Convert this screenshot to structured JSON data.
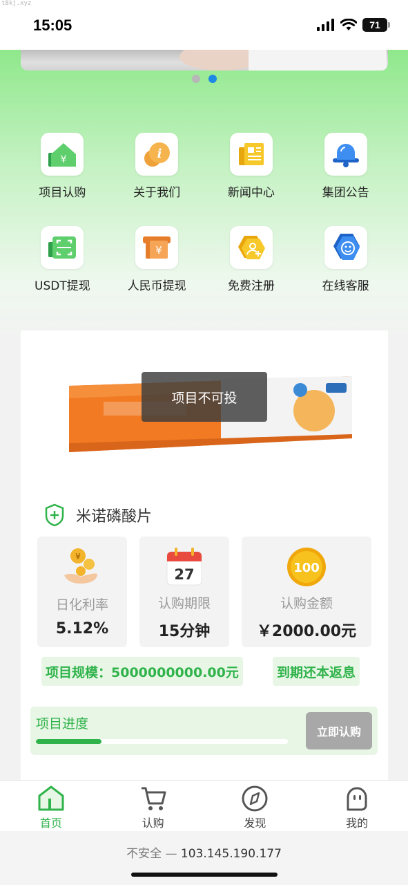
{
  "watermark": "t8kj.xyz",
  "status_bar": {
    "time": "15:05",
    "battery": "71"
  },
  "carousel": {
    "dots": 2,
    "active_index": 1
  },
  "menu": [
    {
      "label": "项目认购",
      "icon": "house-yen-icon"
    },
    {
      "label": "关于我们",
      "icon": "info-coin-icon"
    },
    {
      "label": "新闻中心",
      "icon": "newspaper-icon"
    },
    {
      "label": "集团公告",
      "icon": "bell-icon"
    },
    {
      "label": "USDT提现",
      "icon": "scan-wallet-icon"
    },
    {
      "label": "人民币提现",
      "icon": "atm-yen-icon"
    },
    {
      "label": "免费注册",
      "icon": "add-user-icon"
    },
    {
      "label": "在线客服",
      "icon": "customer-service-icon"
    }
  ],
  "product": {
    "toast": "项目不可投",
    "name": "米诺磷酸片",
    "stats": [
      {
        "label": "日化利率",
        "value": "5.12%",
        "icon": "coins-hand-icon"
      },
      {
        "label": "认购期限",
        "value": "15分钟",
        "icon": "calendar-icon",
        "calendar_day": "27"
      },
      {
        "label": "认购金额",
        "value": "￥2000.00元",
        "icon": "gold-coin-icon",
        "coin_text": "100"
      }
    ],
    "scale_tag": "项目规模：5000000000.00元",
    "return_tag": "到期还本返息",
    "progress_label": "项目进度",
    "progress_fraction": 0.26,
    "buy_button": "立即认购"
  },
  "tabbar": [
    {
      "label": "首页",
      "icon": "home-icon",
      "active": true
    },
    {
      "label": "认购",
      "icon": "cart-icon",
      "active": false
    },
    {
      "label": "发现",
      "icon": "compass-icon",
      "active": false
    },
    {
      "label": "我的",
      "icon": "profile-icon",
      "active": false
    }
  ],
  "address_bar": {
    "security": "不安全",
    "separator": "—",
    "host": "103.145.190.177"
  },
  "colors": {
    "accent": "#2fb34a",
    "active_dot": "#1e88e5",
    "disabled_button": "#a8a8a8"
  }
}
